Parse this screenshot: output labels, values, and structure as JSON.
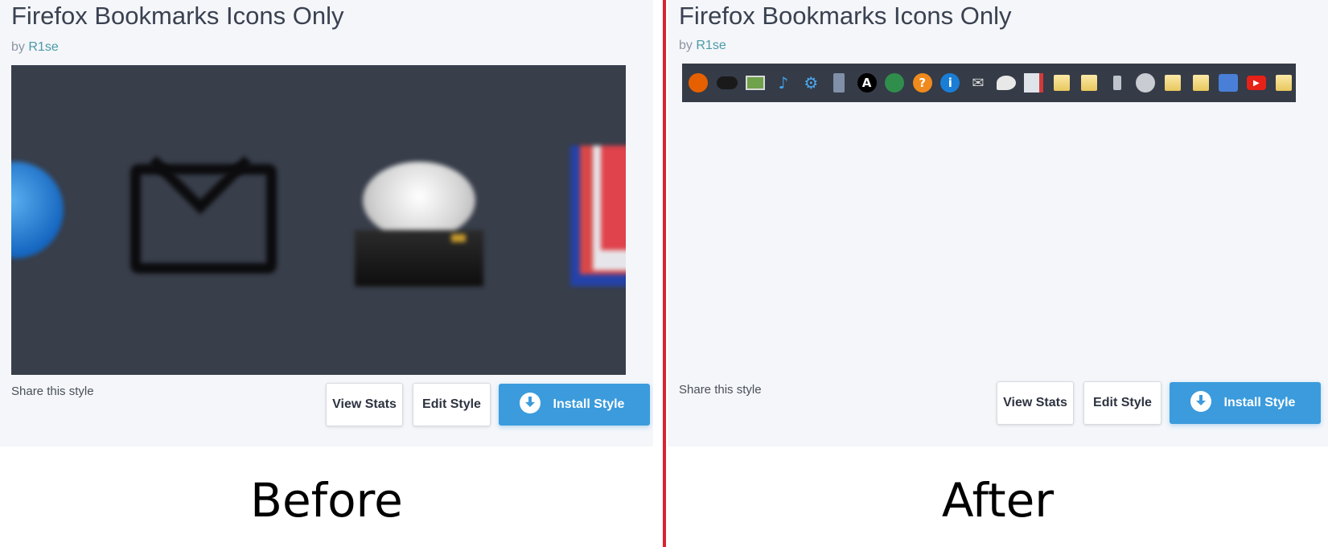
{
  "panels": {
    "before": {
      "title": "Firefox Bookmarks Icons Only",
      "by": "by",
      "author": "R1se",
      "share": "Share this style",
      "buttons": {
        "view_stats": "View Stats",
        "edit_style": "Edit Style",
        "install_style": "Install Style"
      },
      "caption": "Before",
      "preview_icons": [
        "globe-icon",
        "mail-icon",
        "chat-hdd-icon",
        "book-icon"
      ]
    },
    "after": {
      "title": "Firefox Bookmarks Icons Only",
      "by": "by",
      "author": "R1se",
      "share": "Share this style",
      "buttons": {
        "view_stats": "View Stats",
        "edit_style": "Edit Style",
        "install_style": "Install Style"
      },
      "caption": "After",
      "toolbar_icons": [
        {
          "name": "firefox-icon",
          "glyph": "",
          "bg": "#e66000"
        },
        {
          "name": "gamepad-icon",
          "glyph": "",
          "bg": "#1a1a1a"
        },
        {
          "name": "picture-icon",
          "glyph": "",
          "bg": "#6fa24a"
        },
        {
          "name": "music-note-icon",
          "glyph": "♪",
          "bg": "transparent"
        },
        {
          "name": "gear-icon",
          "glyph": "⚙",
          "bg": "transparent"
        },
        {
          "name": "film-icon",
          "glyph": "",
          "bg": "#8090a8"
        },
        {
          "name": "letter-a-icon",
          "glyph": "A",
          "bg": "#000000"
        },
        {
          "name": "globe-icon",
          "glyph": "",
          "bg": "#2f8e4c"
        },
        {
          "name": "help-icon",
          "glyph": "?",
          "bg": "#f08a1c"
        },
        {
          "name": "info-icon",
          "glyph": "i",
          "bg": "#1a7ed6"
        },
        {
          "name": "mail-icon",
          "glyph": "✉",
          "bg": "transparent"
        },
        {
          "name": "chat-icon",
          "glyph": "",
          "bg": "#e8e8e8"
        },
        {
          "name": "book-icon",
          "glyph": "",
          "bg": "#dfe3ea"
        },
        {
          "name": "folder-icon",
          "glyph": "",
          "bg": "#f0d77f"
        },
        {
          "name": "folder-icon",
          "glyph": "",
          "bg": "#f0d77f"
        },
        {
          "name": "phone-icon",
          "glyph": "",
          "bg": "#bfc4cc"
        },
        {
          "name": "clock-icon",
          "glyph": "",
          "bg": "#c9ccd2"
        },
        {
          "name": "folder-icon",
          "glyph": "",
          "bg": "#f0d77f"
        },
        {
          "name": "folder-icon",
          "glyph": "",
          "bg": "#f0d77f"
        },
        {
          "name": "translate-icon",
          "glyph": "",
          "bg": "#4a7fd8"
        },
        {
          "name": "youtube-icon",
          "glyph": "▶",
          "bg": "#e62117"
        },
        {
          "name": "folder-icon",
          "glyph": "",
          "bg": "#f0d77f"
        }
      ]
    }
  },
  "colors": {
    "divider": "#d9232e",
    "install": "#3b9bdc",
    "card": "#f4f6fa",
    "author": "#4a9aa6",
    "preview": "#383e4a"
  }
}
